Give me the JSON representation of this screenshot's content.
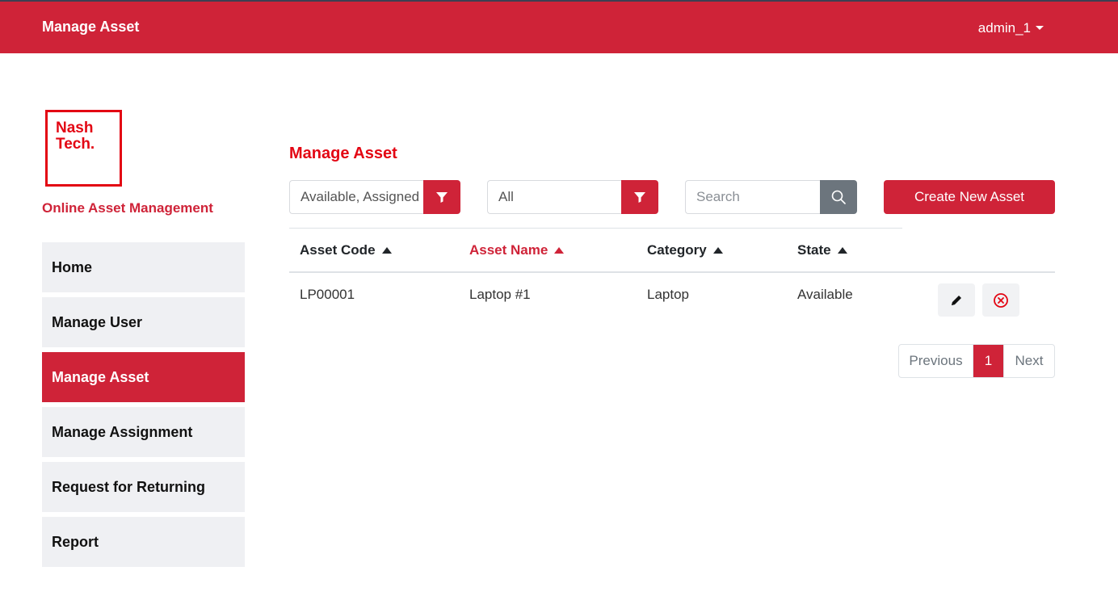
{
  "header": {
    "title": "Manage Asset",
    "user": "admin_1"
  },
  "logo": {
    "line1": "Nash",
    "line2": "Tech."
  },
  "sidebar": {
    "brand": "Online Asset Management",
    "items": [
      {
        "label": "Home"
      },
      {
        "label": "Manage User"
      },
      {
        "label": "Manage Asset"
      },
      {
        "label": "Manage Assignment"
      },
      {
        "label": "Request for Returning"
      },
      {
        "label": "Report"
      }
    ]
  },
  "main": {
    "title": "Manage Asset",
    "state_filter": "Available, Assigned",
    "category_filter": "All",
    "search_placeholder": "Search",
    "create_label": "Create New Asset",
    "columns": [
      "Asset Code",
      "Asset Name",
      "Category",
      "State"
    ],
    "rows": [
      {
        "code": "LP00001",
        "name": "Laptop #1",
        "category": "Laptop",
        "state": "Available"
      }
    ],
    "pagination": {
      "previous": "Previous",
      "current": "1",
      "next": "Next"
    }
  },
  "colors": {
    "accent": "#cf2338",
    "logo": "#e30613"
  }
}
